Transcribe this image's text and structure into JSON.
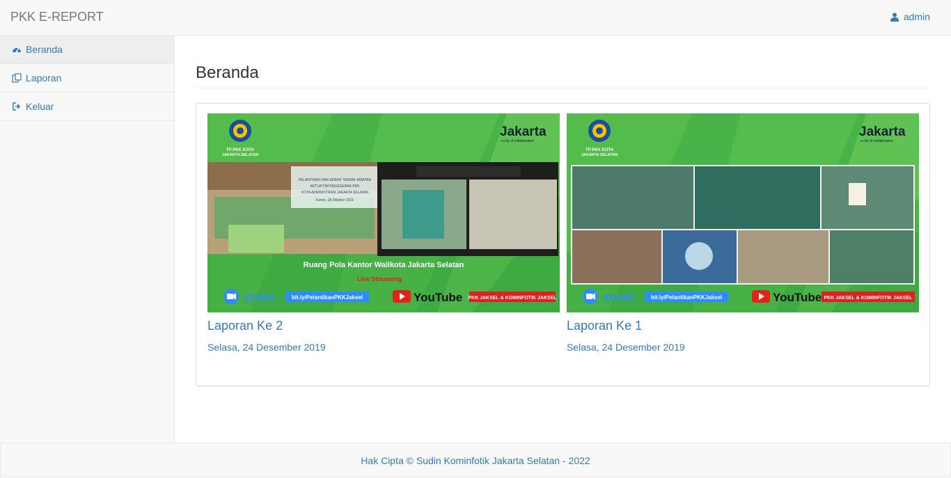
{
  "app": {
    "brand": "PKK E-REPORT",
    "user_label": "admin"
  },
  "sidebar": {
    "items": [
      {
        "label": "Beranda",
        "icon": "dashboard-icon",
        "active": true
      },
      {
        "label": "Laporan",
        "icon": "copy-icon",
        "active": false
      },
      {
        "label": "Keluar",
        "icon": "sign-out-icon",
        "active": false
      }
    ]
  },
  "main": {
    "title": "Beranda",
    "reports": [
      {
        "title": "Laporan Ke 2",
        "date": "Selasa, 24 Desember 2019",
        "thumb": {
          "org_top": "TP PKK KOTA",
          "org_bottom": "JAKARTA SELATAN",
          "city_brand": "Jakarta",
          "city_tagline": "a city of collaboration",
          "banner_line1": "PELANTIKAN DAN SERAH TERIMA JABATAN",
          "banner_line2": "KETUA TIM PENGGERAK PKK",
          "banner_line3": "KOTA ADMINISTRASI JAKARTA SELATAN",
          "banner_date": "Kamis, 28 Oktober 2021",
          "venue": "Ruang Pola Kantor Walikota Jakarta Selatan",
          "stream": "Live Streaming",
          "zoom_label": "zoom",
          "link_label": "bit.ly/PelantikanPKKJaksel",
          "youtube_label": "YouTube",
          "credit": "PKK JAKSEL & KOMINFOTIK JAKSEL"
        }
      },
      {
        "title": "Laporan Ke 1",
        "date": "Selasa, 24 Desember 2019",
        "thumb": {
          "org_top": "TP PKK KOTA",
          "org_bottom": "JAKARTA SELATAN",
          "city_brand": "Jakarta",
          "city_tagline": "a city of collaboration",
          "zoom_label": "zoom",
          "link_label": "bit.ly/PelantikanPKKJaksel",
          "youtube_label": "YouTube",
          "credit": "PKK JAKSEL & KOMINFOTIK JAKSEL"
        }
      }
    ]
  },
  "footer": {
    "text": "Hak Cipta © Sudin Kominfotik Jakarta Selatan - 2022"
  },
  "colors": {
    "link": "#337ab7",
    "brand": "#777777",
    "banner_green": "#4cb84a"
  }
}
